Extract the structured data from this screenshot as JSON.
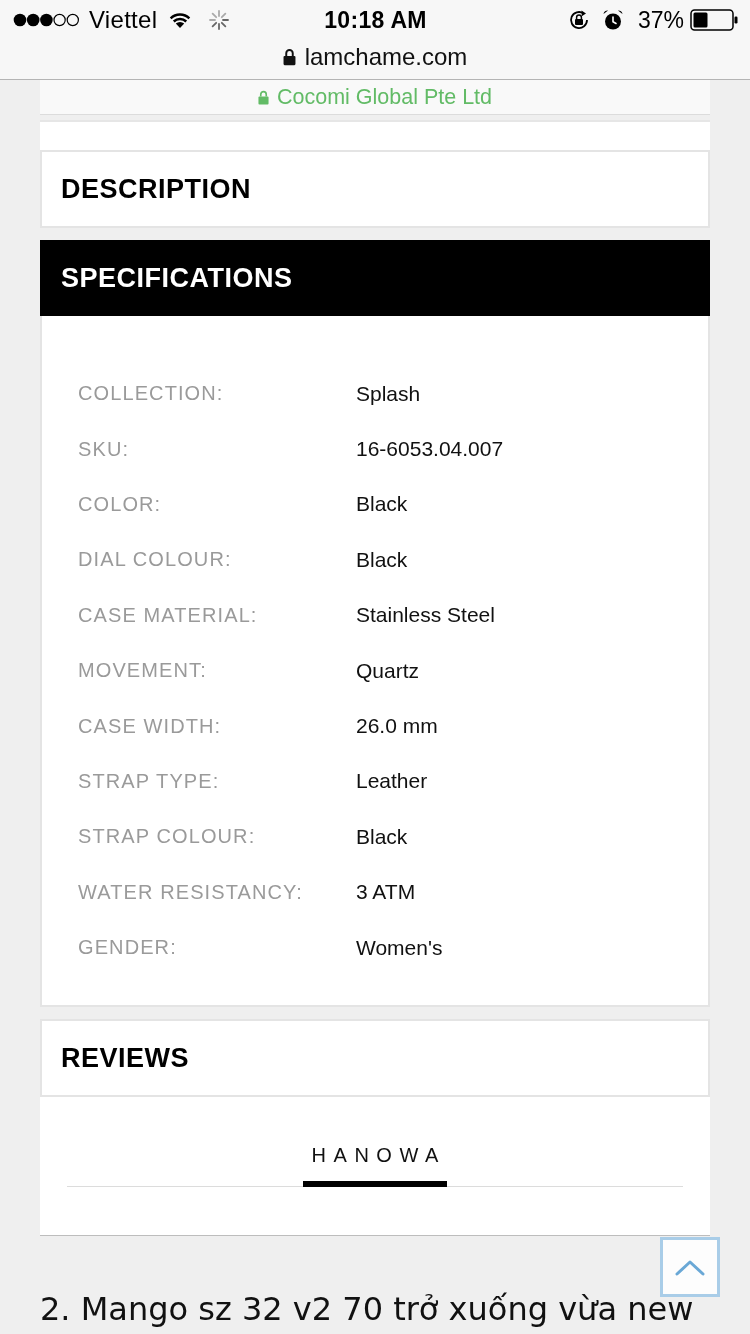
{
  "status_bar": {
    "carrier": "Viettel",
    "time": "10:18 AM",
    "battery": "37%"
  },
  "address_bar": {
    "url": "lamchame.com"
  },
  "certificate_banner": {
    "label": "Cocomi Global Pte Ltd"
  },
  "sections": [
    {
      "title": "DESCRIPTION",
      "expanded": false
    },
    {
      "title": "SPECIFICATIONS",
      "expanded": true,
      "rows": [
        {
          "label": "COLLECTION:",
          "value": "Splash"
        },
        {
          "label": "SKU:",
          "value": "16-6053.04.007"
        },
        {
          "label": "COLOR:",
          "value": "Black"
        },
        {
          "label": "DIAL COLOUR:",
          "value": "Black"
        },
        {
          "label": "CASE MATERIAL:",
          "value": "Stainless Steel"
        },
        {
          "label": "MOVEMENT:",
          "value": "Quartz"
        },
        {
          "label": "CASE WIDTH:",
          "value": "26.0 mm"
        },
        {
          "label": "STRAP TYPE:",
          "value": "Leather"
        },
        {
          "label": "STRAP COLOUR:",
          "value": "Black"
        },
        {
          "label": "WATER RESISTANCY:",
          "value": "3 ATM"
        },
        {
          "label": "GENDER:",
          "value": "Women's"
        }
      ]
    },
    {
      "title": "REVIEWS",
      "expanded": false
    }
  ],
  "brand_tabs": [
    {
      "label": "HANOWA",
      "selected": true
    }
  ],
  "post_text": "2. Mango sz 32 v2 70 trở xuống vừa new"
}
